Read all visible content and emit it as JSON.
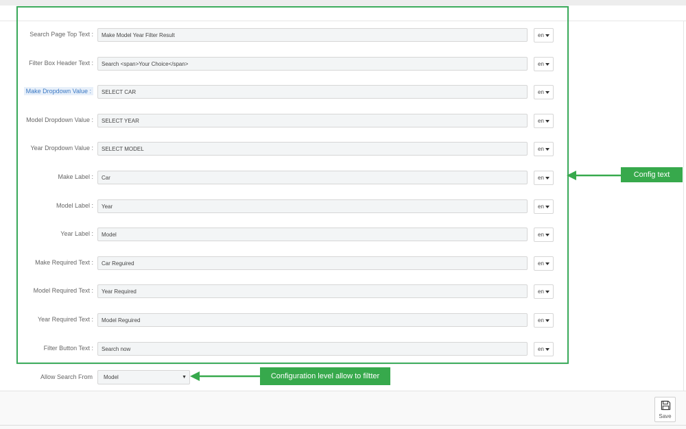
{
  "form": {
    "fields": [
      {
        "label": "Search Page Top Text :",
        "value": "Make Model Year Filter Result",
        "lang": "en",
        "active": false
      },
      {
        "label": "Filter Box Header Text :",
        "value": "Search <span>Your Choice</span>",
        "lang": "en",
        "active": false
      },
      {
        "label": "Make Dropdown Value :",
        "value": "SELECT CAR",
        "lang": "en",
        "active": true
      },
      {
        "label": "Model Dropdown Value :",
        "value": "SELECT YEAR",
        "lang": "en",
        "active": false
      },
      {
        "label": "Year Dropdown Value :",
        "value": "SELECT MODEL",
        "lang": "en",
        "active": false
      },
      {
        "label": "Make Label :",
        "value": "Car",
        "lang": "en",
        "active": false
      },
      {
        "label": "Model Label :",
        "value": "Year",
        "lang": "en",
        "active": false
      },
      {
        "label": "Year Label :",
        "value": "Model",
        "lang": "en",
        "active": false
      },
      {
        "label": "Make Required Text :",
        "value": "Car Reguired",
        "lang": "en",
        "active": false
      },
      {
        "label": "Model Required Text :",
        "value": "Year Required",
        "lang": "en",
        "active": false
      },
      {
        "label": "Year Required Text :",
        "value": "Model Reguired",
        "lang": "en",
        "active": false
      },
      {
        "label": "Filter Button Text :",
        "value": "Search now",
        "lang": "en",
        "active": false
      }
    ],
    "allow_search": {
      "label": "Allow Search From",
      "selected": "Model"
    }
  },
  "annotations": {
    "config_text": "Config text",
    "config_level": "Configuration  level allow to filtter"
  },
  "footer": {
    "save_label": "Save"
  },
  "colors": {
    "accent_green": "#37a94c",
    "active_label": "#3a78c3"
  },
  "icons": {
    "save": "floppy-disk-icon",
    "lang_caret": "caret-down-icon"
  }
}
